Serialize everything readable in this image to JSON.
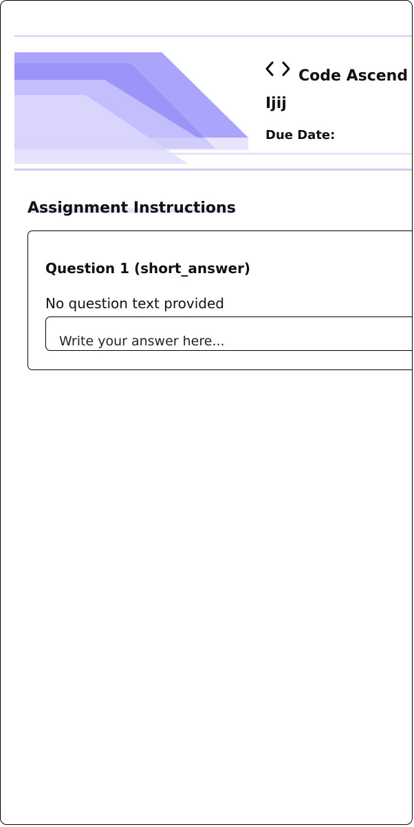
{
  "header": {
    "brand": "Code Ascend",
    "course_title": "Ijij",
    "due_date_label": "Due Date:"
  },
  "instructions": {
    "title": "Assignment Instructions"
  },
  "questions": [
    {
      "title": "Question 1 (short_answer)",
      "text": "No question text provided",
      "answer_placeholder": "Write your answer here..."
    }
  ],
  "colors": {
    "accent_primary": "#aaa4fb",
    "accent_secondary": "#9088f8",
    "accent_light": "#dedbfd",
    "border": "#000000"
  },
  "icons": {
    "brand_icon": "code-brackets-icon"
  }
}
